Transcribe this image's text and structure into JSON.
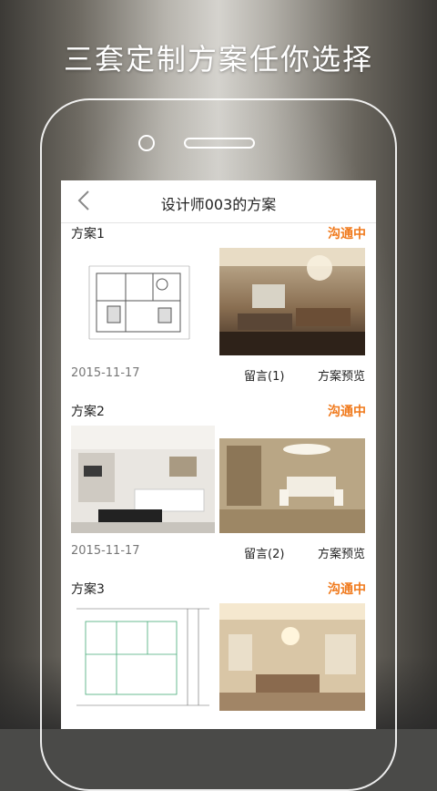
{
  "promo": {
    "headline": "三套定制方案任你选择"
  },
  "navbar": {
    "title": "设计师003的方案",
    "back_icon": "chevron-left-icon"
  },
  "colors": {
    "accent": "#f07a1d",
    "text": "#222222",
    "muted": "#777777"
  },
  "plans": [
    {
      "title": "方案1",
      "status": "沟通中",
      "date": "2015-11-17",
      "message": "留言(1)",
      "preview": "方案预览",
      "images": [
        "floor-plan-drawing",
        "living-room-photo"
      ]
    },
    {
      "title": "方案2",
      "status": "沟通中",
      "date": "2015-11-17",
      "message": "留言(2)",
      "preview": "方案预览",
      "images": [
        "living-room-render",
        "dining-room-render"
      ]
    },
    {
      "title": "方案3",
      "status": "沟通中",
      "images": [
        "cad-floor-plan",
        "european-living-room"
      ]
    }
  ]
}
